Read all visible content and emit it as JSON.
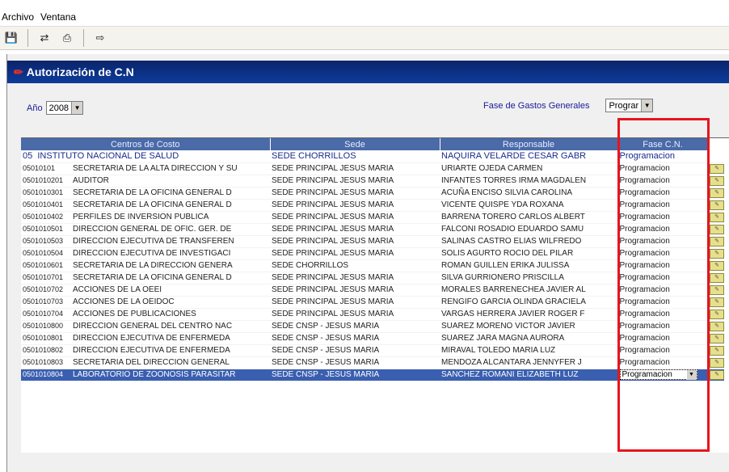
{
  "menu": {
    "items": [
      "Archivo",
      "Ventana"
    ]
  },
  "toolbar": {
    "icons": [
      "save-icon",
      "link-icon",
      "print-icon",
      "exit-icon"
    ]
  },
  "window": {
    "title": "Autorización de C.N"
  },
  "filters": {
    "year_label": "Año",
    "year_value": "2008",
    "fase_label": "Fase de Gastos Generales",
    "fase_value": "Prograr"
  },
  "grid": {
    "headers": [
      "Centros de Costo",
      "Sede",
      "Responsable",
      "Fase C.N."
    ],
    "parent": {
      "code": "05",
      "name": "INSTITUTO NACIONAL  DE SALUD",
      "sede": "SEDE CHORRILLOS",
      "resp": "NAQUIRA VELARDE CESAR GABR",
      "fase": "Programacion"
    },
    "rows": [
      {
        "code": "05010101",
        "name": "SECRETARIA DE LA ALTA DIRECCION Y SU",
        "sede": "SEDE PRINCIPAL JESUS MARIA",
        "resp": "URIARTE OJEDA CARMEN",
        "fase": "Programacion"
      },
      {
        "code": "0501010201",
        "name": "AUDITOR",
        "sede": "SEDE PRINCIPAL JESUS MARIA",
        "resp": "INFANTES TORRES IRMA MAGDALEN",
        "fase": "Programacion"
      },
      {
        "code": "0501010301",
        "name": "SECRETARIA DE LA OFICINA GENERAL D",
        "sede": "SEDE PRINCIPAL JESUS MARIA",
        "resp": "ACUÑA ENCISO SILVIA CAROLINA",
        "fase": "Programacion"
      },
      {
        "code": "0501010401",
        "name": "SECRETARIA DE LA OFICINA GENERAL D",
        "sede": "SEDE PRINCIPAL JESUS MARIA",
        "resp": "VICENTE QUISPE YDA ROXANA",
        "fase": "Programacion"
      },
      {
        "code": "0501010402",
        "name": "PERFILES DE INVERSION PUBLICA",
        "sede": "SEDE PRINCIPAL JESUS MARIA",
        "resp": "BARRENA TORERO CARLOS ALBERT",
        "fase": "Programacion"
      },
      {
        "code": "0501010501",
        "name": "DIRECCION GENERAL DE OFIC. GER. DE",
        "sede": "SEDE PRINCIPAL JESUS MARIA",
        "resp": "FALCONI ROSADIO EDUARDO SAMU",
        "fase": "Programacion"
      },
      {
        "code": "0501010503",
        "name": "DIRECCION EJECUTIVA DE TRANSFEREN",
        "sede": "SEDE PRINCIPAL JESUS MARIA",
        "resp": "SALINAS CASTRO ELIAS WILFREDO",
        "fase": "Programacion"
      },
      {
        "code": "0501010504",
        "name": "DIRECCION EJECUTIVA DE INVESTIGACI",
        "sede": "SEDE PRINCIPAL JESUS MARIA",
        "resp": "SOLIS AGURTO ROCIO DEL PILAR",
        "fase": "Programacion"
      },
      {
        "code": "0501010601",
        "name": "SECRETARIA DE LA DIRECCION GENERA",
        "sede": "SEDE CHORRILLOS",
        "resp": "ROMAN GUILLEN ERIKA JULISSA",
        "fase": "Programacion"
      },
      {
        "code": "0501010701",
        "name": "SECRETARIA DE LA OFICINA GENERAL D",
        "sede": "SEDE PRINCIPAL JESUS MARIA",
        "resp": "SILVA GURRIONERO PRISCILLA",
        "fase": "Programacion"
      },
      {
        "code": "0501010702",
        "name": "ACCIONES DE LA OEEI",
        "sede": "SEDE PRINCIPAL JESUS MARIA",
        "resp": "MORALES BARRENECHEA JAVIER AL",
        "fase": "Programacion"
      },
      {
        "code": "0501010703",
        "name": "ACCIONES DE LA OEIDOC",
        "sede": "SEDE PRINCIPAL JESUS MARIA",
        "resp": "RENGIFO GARCIA OLINDA GRACIELA",
        "fase": "Programacion"
      },
      {
        "code": "0501010704",
        "name": "ACCIONES DE PUBLICACIONES",
        "sede": "SEDE PRINCIPAL JESUS MARIA",
        "resp": "VARGAS HERRERA JAVIER ROGER F",
        "fase": "Programacion"
      },
      {
        "code": "0501010800",
        "name": "DIRECCION GENERAL DEL CENTRO NAC",
        "sede": "SEDE CNSP - JESUS MARIA",
        "resp": "SUAREZ MORENO VICTOR JAVIER",
        "fase": "Programacion"
      },
      {
        "code": "0501010801",
        "name": "DIRECCION EJECUTIVA DE ENFERMEDA",
        "sede": "SEDE CNSP - JESUS MARIA",
        "resp": "SUAREZ JARA MAGNA AURORA",
        "fase": "Programacion"
      },
      {
        "code": "0501010802",
        "name": "DIRECCION EJECUTIVA DE ENFERMEDA",
        "sede": "SEDE CNSP - JESUS MARIA",
        "resp": "MIRAVAL TOLEDO MARIA LUZ",
        "fase": "Programacion"
      },
      {
        "code": "0501010803",
        "name": "SECRETARIA DEL DIRECCION GENERAL",
        "sede": "SEDE CNSP - JESUS MARIA",
        "resp": "MENDOZA ALCANTARA JENNYFER J",
        "fase": "Programacion"
      },
      {
        "code": "0501010804",
        "name": "LABORATORIO DE ZOONOSIS PARASITAR",
        "sede": "SEDE CNSP - JESUS MARIA",
        "resp": "SANCHEZ ROMANI ELIZABETH LUZ",
        "fase": "Programacion"
      }
    ],
    "selected_index": 17,
    "edit_button_icon": "edit-icon"
  },
  "colors": {
    "header_bg": "#4a6aa8",
    "title_bg": "#0a246a",
    "highlight": "#e8141c",
    "selected_bg": "#3a5fb0"
  }
}
